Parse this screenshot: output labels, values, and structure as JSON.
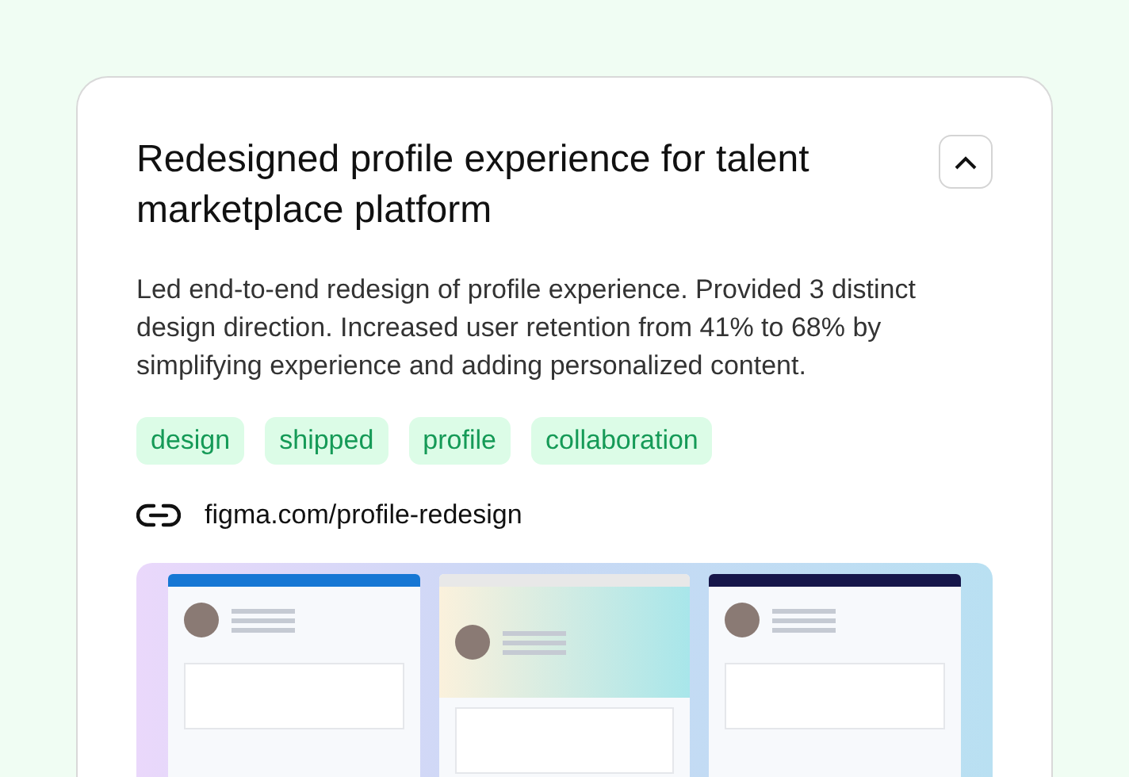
{
  "card": {
    "title": "Redesigned profile experience for talent marketplace platform",
    "expanded": true,
    "description": "Led end-to-end redesign of profile experience. Provided 3 distinct design direction. Increased user retention from 41% to 68% by simplifying experience and adding personalized content.",
    "tags": [
      "design",
      "shipped",
      "profile",
      "collaboration"
    ],
    "link": "figma.com/profile-redesign"
  }
}
